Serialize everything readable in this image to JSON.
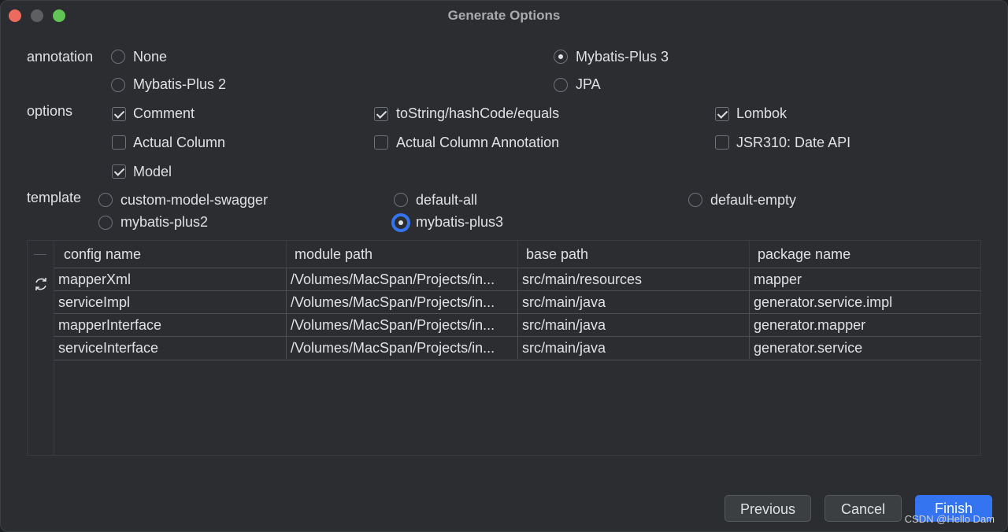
{
  "window": {
    "title": "Generate Options"
  },
  "annotation": {
    "label": "annotation",
    "options": [
      {
        "label": "None",
        "selected": false
      },
      {
        "label": "Mybatis-Plus 3",
        "selected": true
      },
      {
        "label": "Mybatis-Plus 2",
        "selected": false
      },
      {
        "label": "JPA",
        "selected": false
      }
    ]
  },
  "options": {
    "label": "options",
    "checkboxes": [
      {
        "label": "Comment",
        "checked": true
      },
      {
        "label": "toString/hashCode/equals",
        "checked": true
      },
      {
        "label": "Lombok",
        "checked": true
      },
      {
        "label": "Actual Column",
        "checked": false
      },
      {
        "label": "Actual Column Annotation",
        "checked": false
      },
      {
        "label": "JSR310: Date API",
        "checked": false
      },
      {
        "label": "Model",
        "checked": true
      }
    ]
  },
  "template": {
    "label": "template",
    "options": [
      {
        "label": "custom-model-swagger",
        "selected": false
      },
      {
        "label": "default-all",
        "selected": false
      },
      {
        "label": "default-empty",
        "selected": false
      },
      {
        "label": "mybatis-plus2",
        "selected": false
      },
      {
        "label": "mybatis-plus3",
        "selected": true
      }
    ]
  },
  "table": {
    "headers": [
      "config name",
      "module path",
      "base path",
      "package name"
    ],
    "rows": [
      [
        "mapperXml",
        "/Volumes/MacSpan/Projects/in...",
        "src/main/resources",
        "mapper"
      ],
      [
        "serviceImpl",
        "/Volumes/MacSpan/Projects/in...",
        "src/main/java",
        "generator.service.impl"
      ],
      [
        "mapperInterface",
        "/Volumes/MacSpan/Projects/in...",
        "src/main/java",
        "generator.mapper"
      ],
      [
        "serviceInterface",
        "/Volumes/MacSpan/Projects/in...",
        "src/main/java",
        "generator.service"
      ]
    ]
  },
  "buttons": {
    "previous": "Previous",
    "cancel": "Cancel",
    "finish": "Finish"
  },
  "watermark": "CSDN @Hello Dam",
  "colors": {
    "background": "#2b2d30",
    "accent": "#3574f0",
    "text": "#dfe1e5"
  }
}
